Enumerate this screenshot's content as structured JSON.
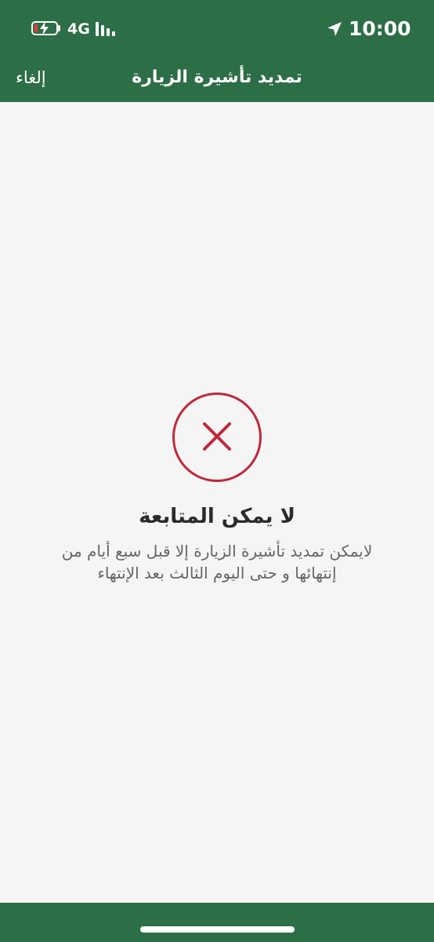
{
  "status_bar": {
    "network": "4G",
    "time": "10:00",
    "icons": [
      "battery-charging-icon",
      "signal-icon",
      "location-arrow-icon"
    ]
  },
  "nav": {
    "cancel_label": "إلغاء",
    "title": "تمديد تأشيرة الزيارة"
  },
  "error": {
    "icon": "error-x-icon",
    "title": "لا يمكن المتابعة",
    "message_line1": "لايمكن تمديد تأشيرة الزيارة إلا قبل سبع أيام من",
    "message_line2": "إنتهائها و حتى اليوم الثالث بعد الإنتهاء"
  },
  "colors": {
    "header_bg": "#2c6e45",
    "background": "#f5f5f5",
    "error_red": "#c0283a",
    "title_text": "#2b2b2b",
    "message_text": "#666666"
  }
}
